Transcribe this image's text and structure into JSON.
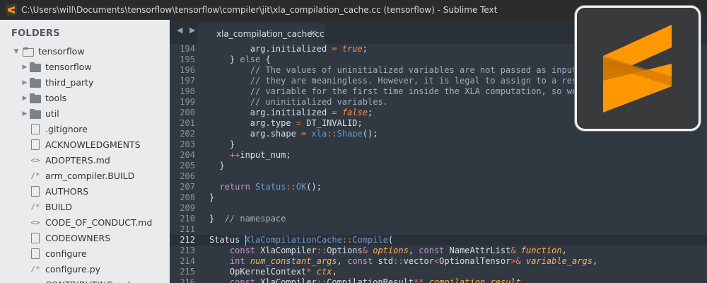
{
  "window": {
    "title": "C:\\Users\\will\\Documents\\tensorflow\\tensorflow\\compiler\\jit\\xla_compilation_cache.cc (tensorflow) - Sublime Text"
  },
  "sidebar": {
    "header": "FOLDERS",
    "items": [
      {
        "label": "tensorflow",
        "icon": "folder-open-icon",
        "arrow": "▼"
      },
      {
        "label": "tensorflow",
        "icon": "folder-icon",
        "arrow": "▶"
      },
      {
        "label": "third_party",
        "icon": "folder-icon",
        "arrow": "▶"
      },
      {
        "label": "tools",
        "icon": "folder-icon",
        "arrow": "▶"
      },
      {
        "label": "util",
        "icon": "folder-icon",
        "arrow": "▶"
      },
      {
        "label": ".gitignore",
        "icon": "file-icon"
      },
      {
        "label": "ACKNOWLEDGMENTS",
        "icon": "file-icon"
      },
      {
        "label": "ADOPTERS.md",
        "icon": "code-file-icon",
        "glyph": "<>"
      },
      {
        "label": "arm_compiler.BUILD",
        "icon": "comment-file-icon",
        "glyph": "/*"
      },
      {
        "label": "AUTHORS",
        "icon": "file-icon"
      },
      {
        "label": "BUILD",
        "icon": "comment-file-icon",
        "glyph": "/*"
      },
      {
        "label": "CODE_OF_CONDUCT.md",
        "icon": "code-file-icon",
        "glyph": "<>"
      },
      {
        "label": "CODEOWNERS",
        "icon": "file-icon"
      },
      {
        "label": "configure",
        "icon": "file-icon"
      },
      {
        "label": "configure.py",
        "icon": "comment-file-icon",
        "glyph": "/*"
      },
      {
        "label": "CONTRIBUTING.md",
        "icon": "code-file-icon",
        "glyph": "<>"
      }
    ]
  },
  "tabs": {
    "nav": "◀ ▶",
    "active": {
      "label": "xla_compilation_cache.cc",
      "close": "✕"
    }
  },
  "editor": {
    "active_line": "212",
    "lines": [
      {
        "n": "194",
        "tokens": [
          [
            "p",
            "        arg.initialized "
          ],
          [
            "o",
            "="
          ],
          [
            "p",
            " "
          ],
          [
            "n",
            "true"
          ],
          [
            "p",
            ";"
          ]
        ]
      },
      {
        "n": "195",
        "tokens": [
          [
            "p",
            "    } "
          ],
          [
            "k",
            "else"
          ],
          [
            "p",
            " {"
          ]
        ]
      },
      {
        "n": "196",
        "tokens": [
          [
            "c",
            "        // The values of uninitialized variables are not passed as inputs, s"
          ]
        ]
      },
      {
        "n": "197",
        "tokens": [
          [
            "c",
            "        // they are meaningless. However, it is legal to assign to a resourc"
          ]
        ]
      },
      {
        "n": "198",
        "tokens": [
          [
            "c",
            "        // variable for the first time inside the XLA computation, so we do"
          ]
        ]
      },
      {
        "n": "199",
        "tokens": [
          [
            "c",
            "        // uninitialized variables."
          ]
        ]
      },
      {
        "n": "200",
        "tokens": [
          [
            "p",
            "        arg.initialized "
          ],
          [
            "o",
            "="
          ],
          [
            "p",
            " "
          ],
          [
            "n",
            "false"
          ],
          [
            "p",
            ";"
          ]
        ]
      },
      {
        "n": "201",
        "tokens": [
          [
            "p",
            "        arg.type "
          ],
          [
            "o",
            "="
          ],
          [
            "p",
            " DT_INVALID;"
          ]
        ]
      },
      {
        "n": "202",
        "tokens": [
          [
            "p",
            "        arg.shape "
          ],
          [
            "o",
            "="
          ],
          [
            "p",
            " "
          ],
          [
            "s",
            "xla"
          ],
          [
            "o",
            "::"
          ],
          [
            "f",
            "Shape"
          ],
          [
            "p",
            "();"
          ]
        ]
      },
      {
        "n": "203",
        "tokens": [
          [
            "p",
            "    }"
          ]
        ]
      },
      {
        "n": "204",
        "tokens": [
          [
            "o",
            "    ++"
          ],
          [
            "p",
            "input_num;"
          ]
        ]
      },
      {
        "n": "205",
        "tokens": [
          [
            "p",
            "  }"
          ]
        ]
      },
      {
        "n": "206",
        "tokens": []
      },
      {
        "n": "207",
        "tokens": [
          [
            "k",
            "  return"
          ],
          [
            "p",
            " "
          ],
          [
            "s",
            "Status"
          ],
          [
            "o",
            "::"
          ],
          [
            "f",
            "OK"
          ],
          [
            "p",
            "();"
          ]
        ]
      },
      {
        "n": "208",
        "tokens": [
          [
            "p",
            "}"
          ]
        ]
      },
      {
        "n": "209",
        "tokens": []
      },
      {
        "n": "210",
        "tokens": [
          [
            "p",
            "}  "
          ],
          [
            "c",
            "// namespace"
          ]
        ]
      },
      {
        "n": "211",
        "tokens": []
      },
      {
        "n": "212",
        "tokens": [
          [
            "t",
            "Status "
          ],
          [
            "s",
            "XlaCompilationCache"
          ],
          [
            "o",
            "::"
          ],
          [
            "f",
            "Compile"
          ],
          [
            "p",
            "("
          ]
        ]
      },
      {
        "n": "213",
        "tokens": [
          [
            "k",
            "    const"
          ],
          [
            "p",
            " XlaCompiler"
          ],
          [
            "o",
            "::"
          ],
          [
            "p",
            "Options"
          ],
          [
            "o",
            "&"
          ],
          [
            "p",
            " "
          ],
          [
            "pa",
            "options"
          ],
          [
            "p",
            ", "
          ],
          [
            "k",
            "const"
          ],
          [
            "p",
            " NameAttrList"
          ],
          [
            "o",
            "&"
          ],
          [
            "p",
            " "
          ],
          [
            "pa",
            "function"
          ],
          [
            "p",
            ","
          ]
        ]
      },
      {
        "n": "214",
        "tokens": [
          [
            "k",
            "    int"
          ],
          [
            "p",
            " "
          ],
          [
            "pa",
            "num_constant_args"
          ],
          [
            "p",
            ", "
          ],
          [
            "k",
            "const"
          ],
          [
            "p",
            " std"
          ],
          [
            "o",
            "::"
          ],
          [
            "p",
            "vector"
          ],
          [
            "o",
            "<"
          ],
          [
            "p",
            "OptionalTensor"
          ],
          [
            "o",
            ">&"
          ],
          [
            "p",
            " "
          ],
          [
            "pa",
            "variable_args"
          ],
          [
            "p",
            ","
          ]
        ]
      },
      {
        "n": "215",
        "tokens": [
          [
            "p",
            "    OpKernelContext"
          ],
          [
            "o",
            "*"
          ],
          [
            "p",
            " "
          ],
          [
            "pa",
            "ctx"
          ],
          [
            "p",
            ","
          ]
        ]
      },
      {
        "n": "216",
        "tokens": [
          [
            "k",
            "    const"
          ],
          [
            "p",
            " XlaCompiler"
          ],
          [
            "o",
            "::"
          ],
          [
            "p",
            "CompilationResult"
          ],
          [
            "o",
            "**"
          ],
          [
            "p",
            " "
          ],
          [
            "pa",
            "compilation_result"
          ],
          [
            "p",
            ","
          ]
        ]
      }
    ]
  },
  "colors": {
    "editor_bg": "#303841",
    "sidebar_bg": "#e9ebed",
    "logo_orange": "#ff9800",
    "logo_bg": "#383a3c"
  }
}
